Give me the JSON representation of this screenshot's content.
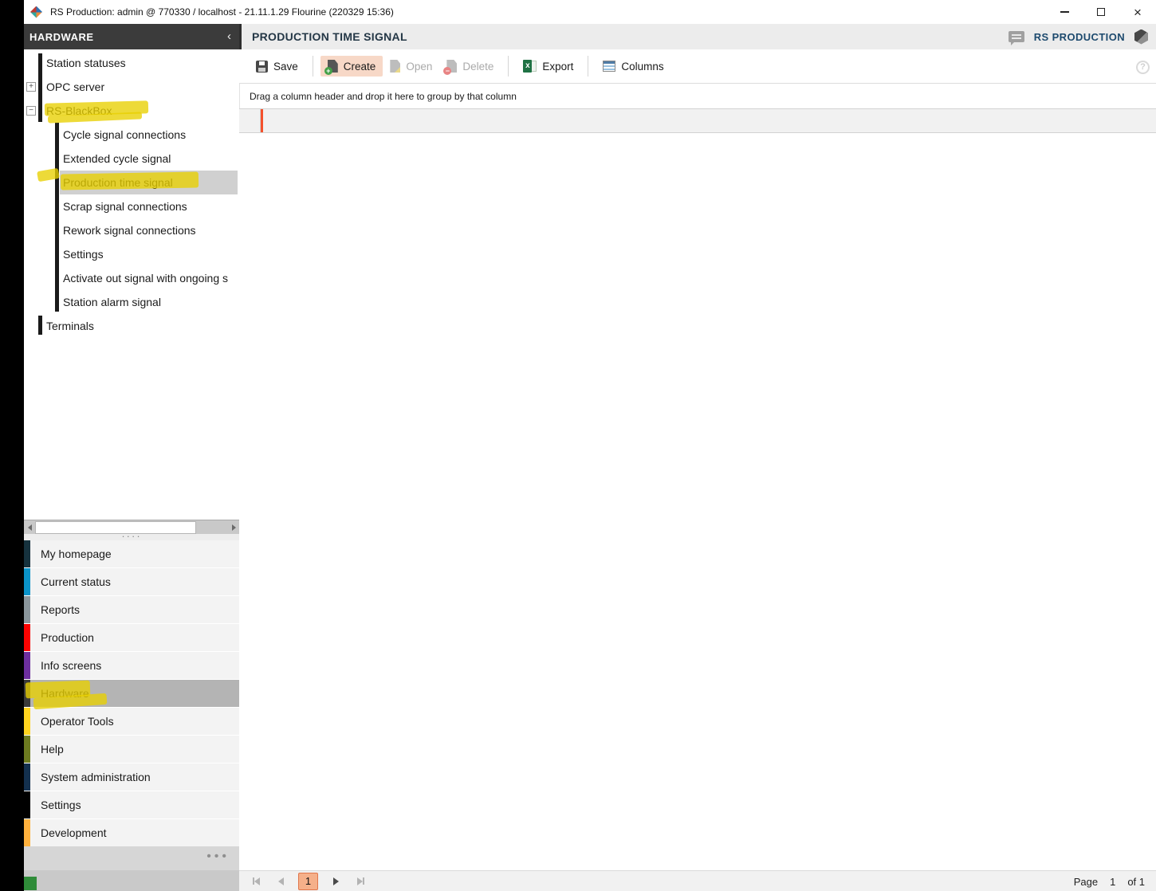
{
  "window": {
    "title": "RS Production: admin @ 770330 / localhost - 21.11.1.29 Flourine (220329 15:36)",
    "close_glyph": "×"
  },
  "sidebar": {
    "header": "HARDWARE",
    "collapse_chevron": "‹",
    "expander_collapsed": "+",
    "expander_expanded": "−",
    "splitter_dots": "····",
    "footer_dots": "•••",
    "tree": [
      {
        "label": "Station statuses"
      },
      {
        "label": "OPC server"
      },
      {
        "label": "RS-BlackBox"
      },
      {
        "label": "Cycle signal connections"
      },
      {
        "label": "Extended cycle signal"
      },
      {
        "label": "Production time signal"
      },
      {
        "label": "Scrap signal connections"
      },
      {
        "label": "Rework signal connections"
      },
      {
        "label": "Settings"
      },
      {
        "label": "Activate out signal with ongoing s"
      },
      {
        "label": "Station alarm signal"
      },
      {
        "label": "Terminals"
      }
    ],
    "menu": [
      {
        "label": "My homepage",
        "color": "#16323e"
      },
      {
        "label": "Current status",
        "color": "#0a93c9"
      },
      {
        "label": "Reports",
        "color": "#8a969c"
      },
      {
        "label": "Production",
        "color": "#fb0200"
      },
      {
        "label": "Info screens",
        "color": "#6d2f9e"
      },
      {
        "label": "Hardware",
        "color": "#3a3a3a"
      },
      {
        "label": "Operator Tools",
        "color": "#ffd41f"
      },
      {
        "label": "Help",
        "color": "#6d7b20"
      },
      {
        "label": "System administration",
        "color": "#13304e"
      },
      {
        "label": "Settings",
        "color": "#000000"
      },
      {
        "label": "Development",
        "color": "#ffb13d"
      }
    ]
  },
  "content": {
    "title": "PRODUCTION TIME SIGNAL",
    "brand": "RS PRODUCTION",
    "drag_hint": "Drag a column header and drop it here to group by that column",
    "help_glyph": "?"
  },
  "toolbar": {
    "save": "Save",
    "create": "Create",
    "open": "Open",
    "delete": "Delete",
    "export": "Export",
    "columns": "Columns"
  },
  "pagination": {
    "page_label": "Page",
    "current": "1",
    "of_label": "of 1"
  },
  "colors": {
    "highlight_marker": "#e8d000",
    "selected_tree_row": "#d0d0d0",
    "create_button_bg": "#f7d8c7",
    "grid_accent_orange": "#f4512c",
    "page_button_bg": "#f5b08a"
  }
}
